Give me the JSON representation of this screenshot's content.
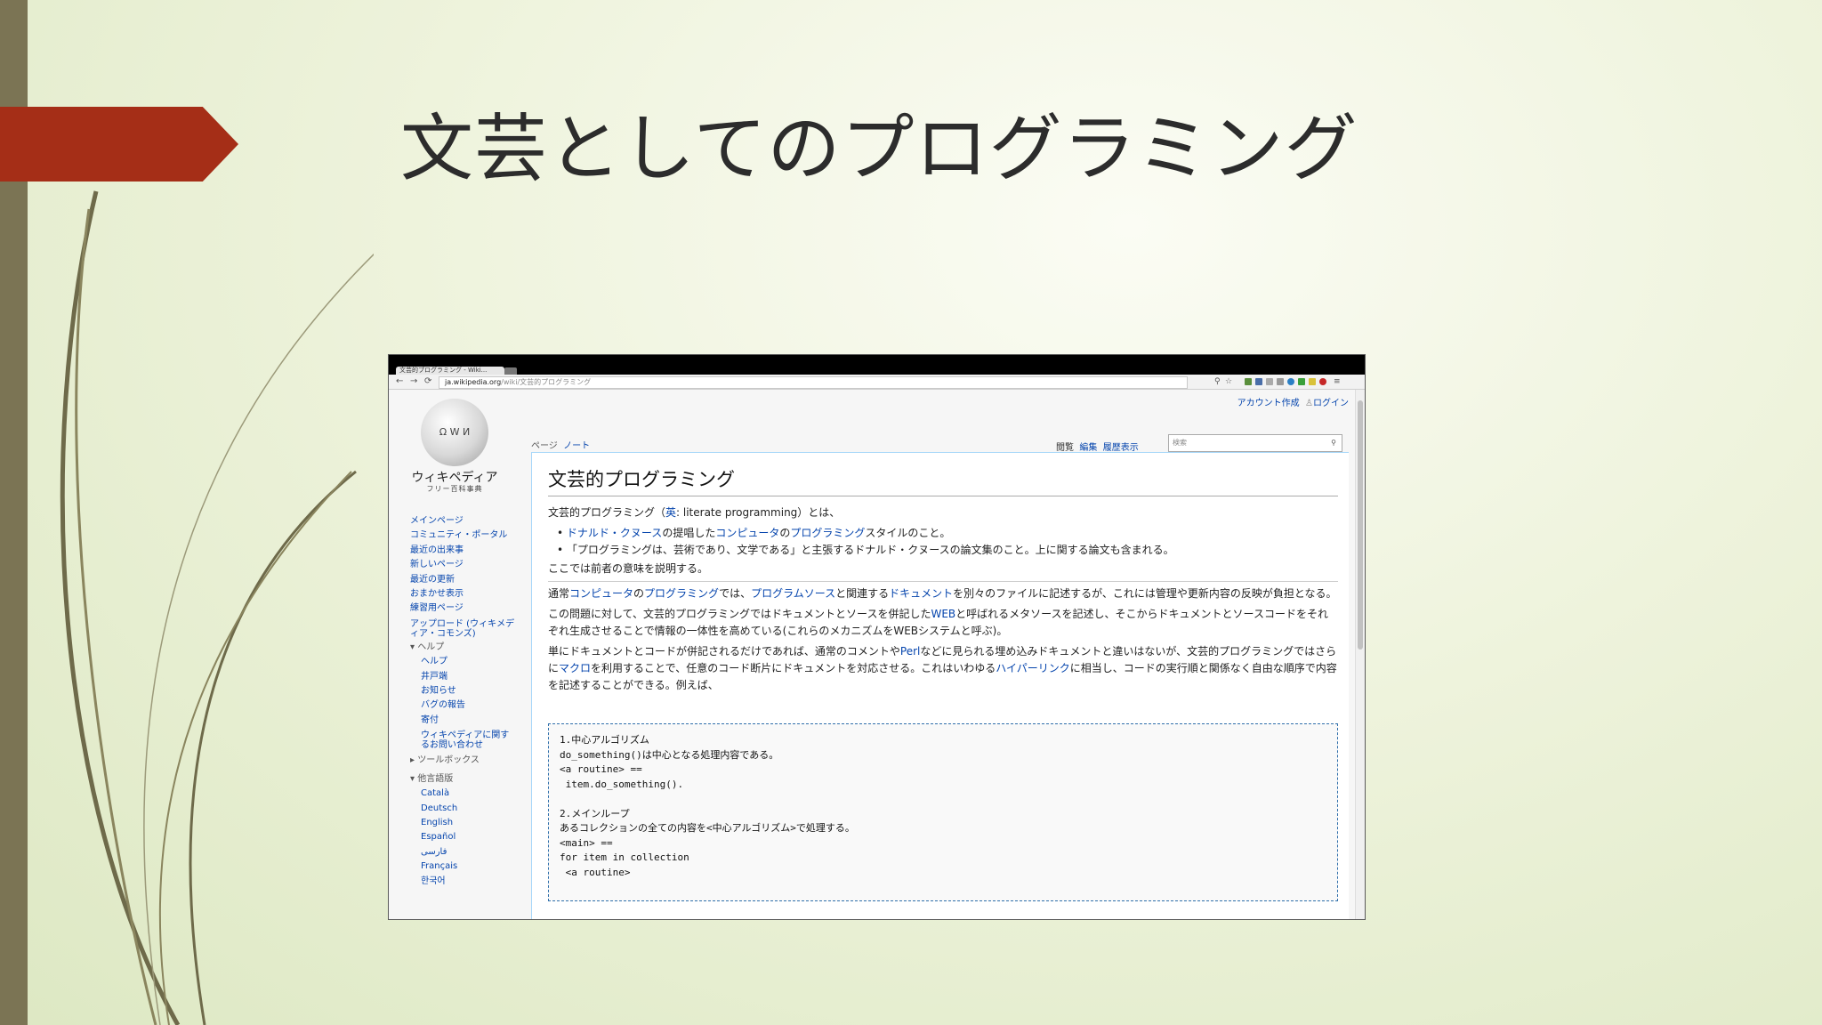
{
  "slide": {
    "title": "文芸としてのプログラミング"
  },
  "browser": {
    "tab_title": "文芸的プログラミング - Wiki...",
    "url_host": "ja.wikipedia.org",
    "url_path": "/wiki/文芸的プログラミング",
    "back_icon": "back-arrow-icon",
    "forward_icon": "forward-arrow-icon",
    "reload_icon": "reload-icon"
  },
  "wiki": {
    "personal": {
      "create_account": "アカウント作成",
      "login": "ログイン"
    },
    "logo": {
      "name": "ウィキペディア",
      "sub": "フリー百科事典"
    },
    "nav": {
      "main_page": "メインページ",
      "portal": "コミュニティ・ポータル",
      "recent_events": "最近の出来事",
      "new_pages": "新しいページ",
      "recent_changes": "最近の更新",
      "random": "おまかせ表示",
      "sandbox": "練習用ページ",
      "upload": "アップロード (ウィキメディア・コモンズ)",
      "help_header": "ヘルプ",
      "help": "ヘルプ",
      "village_pump": "井戸端",
      "notices": "お知らせ",
      "bug_reports": "バグの報告",
      "donate": "寄付",
      "contact": "ウィキペディアに関するお問い合わせ",
      "toolbox": "ツールボックス",
      "languages_header": "他言語版",
      "languages": [
        "Català",
        "Deutsch",
        "English",
        "Español",
        "فارسی",
        "Français",
        "한국어"
      ]
    },
    "tabs": {
      "page": "ページ",
      "talk": "ノート",
      "read": "閲覧",
      "edit": "編集",
      "history": "履歴表示",
      "search_placeholder": "検索"
    },
    "article": {
      "title": "文芸的プログラミング",
      "intro_a": "文芸的プログラミング（",
      "intro_link": "英",
      "intro_b": ": literate programming）とは、",
      "bullet1_l1": "ドナルド・クヌース",
      "bullet1_t1": "の提唱した",
      "bullet1_l2": "コンピュータ",
      "bullet1_t2": "の",
      "bullet1_l3": "プログラミング",
      "bullet1_t3": "スタイルのこと。",
      "bullet2": "「プログラミングは、芸術であり、文学である」と主張するドナルド・クヌースの論文集のこと。上に関する論文も含まれる。",
      "note": "ここでは前者の意味を説明する。",
      "p1_t1": "通常",
      "p1_l1": "コンピュータ",
      "p1_t2": "の",
      "p1_l2": "プログラミング",
      "p1_t3": "では、",
      "p1_l3": "プログラムソース",
      "p1_t4": "と関連する",
      "p1_l4": "ドキュメント",
      "p1_t5": "を別々のファイルに記述するが、これには管理や更新内容の反映が負担となる。",
      "p2_t1": "この問題に対して、文芸的プログラミングではドキュメントとソースを併記した",
      "p2_l1": "WEB",
      "p2_t2": "と呼ばれるメタソースを記述し、そこからドキュメントとソースコードをそれぞれ生成させることで情報の一体性を高めている(これらのメカニズムをWEBシステムと呼ぶ)。",
      "p3_t1": "単にドキュメントとコードが併記されるだけであれば、通常のコメントや",
      "p3_l1": "Perl",
      "p3_t2": "などに見られる埋め込みドキュメントと違いはないが、文芸的プログラミングではさらに",
      "p3_l2": "マクロ",
      "p3_t3": "を利用することで、任意のコード断片にドキュメントを対応させる。これはいわゆる",
      "p3_l3": "ハイパーリンク",
      "p3_t4": "に相当し、コードの実行順と関係なく自由な順序で内容を記述することができる。例えば、",
      "code": "1.中心アルゴリズム\ndo_something()は中心となる処理内容である。\n<a routine> ==\n item.do_something().\n\n2.メインループ\nあるコレクションの全ての内容を<中心アルゴリズム>で処理する。\n<main> ==\nfor item in collection\n <a routine>"
    }
  }
}
